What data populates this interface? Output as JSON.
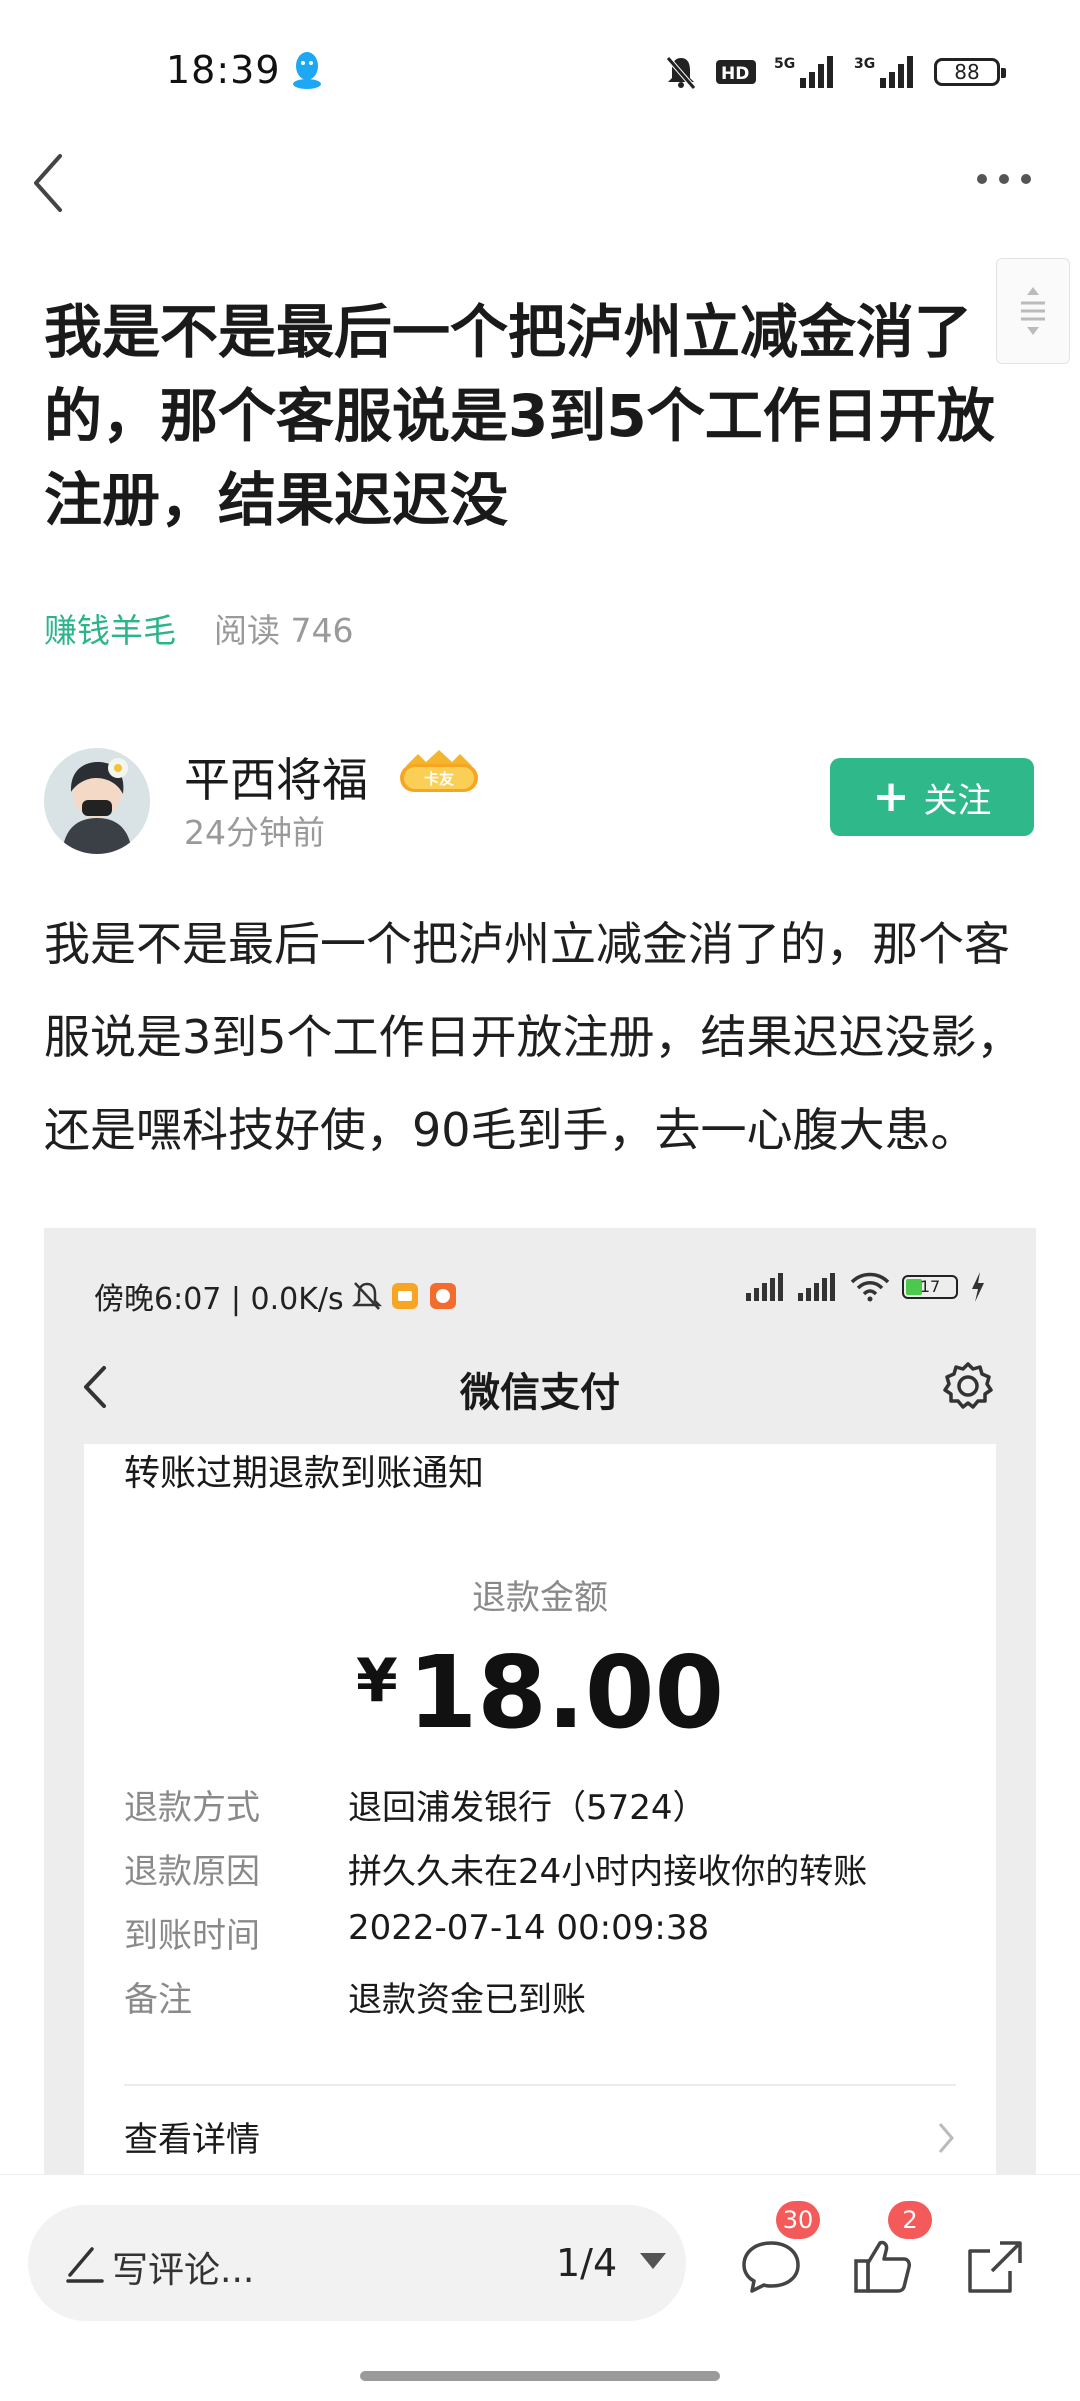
{
  "status_bar": {
    "time": "18:39",
    "signal_5g": "5G",
    "signal_3g": "3G",
    "hd": "HD",
    "battery": "88"
  },
  "article": {
    "title": "我是不是最后一个把泸州立减金消了的，那个客服说是3到5个工作日开放注册，结果迟迟没",
    "category": "赚钱羊毛",
    "reads": "阅读 746"
  },
  "author": {
    "name": "平西将福",
    "badge": "卡友",
    "time": "24分钟前",
    "follow_label": "关注",
    "follow_plus": "+"
  },
  "body_text": "我是不是最后一个把泸州立减金消了的，那个客服说是3到5个工作日开放注册，结果迟迟没影，还是嘿科技好使，90毛到手，去一心腹大患。",
  "screenshot": {
    "status_left": "傍晚6:07 | 0.0K/s",
    "battery": "17",
    "header_title": "微信支付",
    "card_heading": "转账过期退款到账通知",
    "refund_label": "退款金额",
    "currency": "¥",
    "amount": "18.00",
    "rows": [
      {
        "key": "退款方式",
        "value": "退回浦发银行（5724）"
      },
      {
        "key": "退款原因",
        "value": "拼久久未在24小时内接收你的转账"
      },
      {
        "key": "到账时间",
        "value": "2022-07-14 00:09:38"
      },
      {
        "key": "备注",
        "value": "退款资金已到账"
      }
    ],
    "details_link": "查看详情"
  },
  "bottom_bar": {
    "comment_placeholder": "写评论...",
    "page_indicator": "1/4",
    "comment_count": "30",
    "like_count": "2"
  },
  "colors": {
    "accent_green": "#2fb88a",
    "badge_red": "#f45a5a"
  }
}
